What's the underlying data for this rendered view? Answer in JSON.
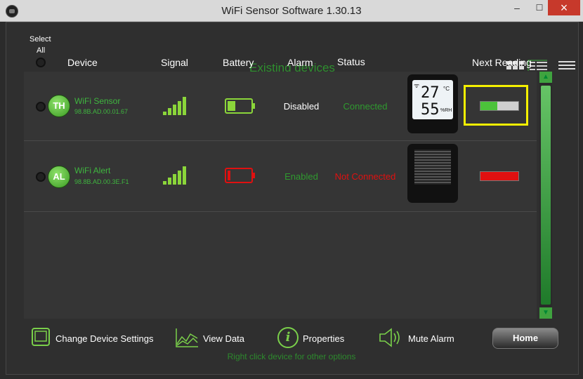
{
  "window": {
    "title": "WiFi Sensor Software 1.30.13",
    "min_glyph": "–",
    "max_glyph": "☐",
    "close_glyph": "×"
  },
  "header": {
    "select_all_line1": "Select",
    "select_all_line2": "All",
    "existing": "Existing devices",
    "columns": {
      "device": "Device",
      "signal": "Signal",
      "battery": "Battery",
      "alarm": "Alarm",
      "status": "Status",
      "next_reading": "Next Reading"
    }
  },
  "devices": [
    {
      "badge": "TH",
      "name": "WiFi Sensor",
      "mac": "98.8B.AD.00.01.67",
      "alarm": "Disabled",
      "status": "Connected",
      "display_temp": "27",
      "display_temp_unit": "°C",
      "display_hum": "55",
      "display_hum_unit": "%RH",
      "battery_level": 0.35,
      "next_reading_progress": 0.45,
      "colors": {
        "alarm": "#ffffff",
        "status": "#2f9a2f",
        "battery": "#8bd63a",
        "progress": "#4cc23a"
      }
    },
    {
      "badge": "AL",
      "name": "WiFi Alert",
      "mac": "98.8B.AD.00.3E.F1",
      "alarm": "Enabled",
      "status": "Not Connected",
      "battery_level": 0.12,
      "next_reading_progress": 1.0,
      "colors": {
        "alarm": "#2f9a2f",
        "status": "#e01010",
        "battery": "#e01010",
        "progress": "#e01010"
      }
    }
  ],
  "toolbar": {
    "change_settings": "Change Device Settings",
    "view_data": "View Data",
    "properties": "Properties",
    "mute_alarm": "Mute Alarm",
    "home": "Home",
    "hint": "Right click device for other options",
    "properties_glyph": "i"
  },
  "icons": {
    "app": "app-icon",
    "grid_view": "grid-view-icon",
    "list_view": "list-view-icon",
    "compact_view": "compact-view-icon",
    "tablet": "tablet-icon",
    "chart": "chart-icon",
    "info": "info-icon",
    "speaker": "speaker-icon"
  },
  "colors": {
    "accent_green": "#3fb53f",
    "highlight_yellow": "#f5f000",
    "alert_red": "#e01010"
  }
}
